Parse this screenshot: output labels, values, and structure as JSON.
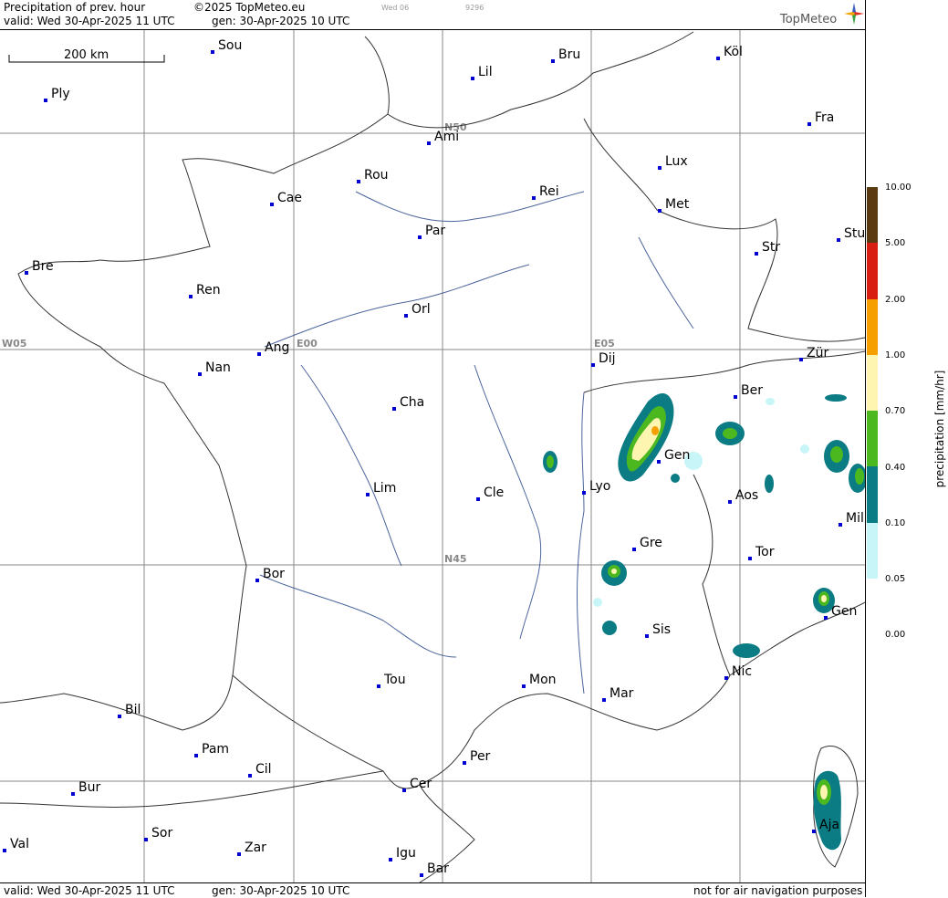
{
  "header": {
    "title": "Precipitation of prev. hour",
    "copyright": "©2025 TopMeteo.eu",
    "valid_line": "valid:  Wed  30-Apr-2025  11 UTC",
    "gen_line": "gen: 30-Apr-2025 10 UTC",
    "small_tag1": "Wed 06",
    "small_tag2": "9296"
  },
  "logo": {
    "text": "TopMeteo",
    "icon": "compass-star-icon"
  },
  "footer": {
    "valid_line": "valid:  Wed  30-Apr-2025  11 UTC",
    "gen_line": "gen: 30-Apr-2025 10 UTC",
    "disclaimer": "not for air navigation purposes"
  },
  "scale_bar": {
    "label": "200 km"
  },
  "grid_labels": {
    "n50": "N50",
    "n45": "N45",
    "w05": "W05",
    "e00": "E00",
    "e05": "E05"
  },
  "cities": [
    {
      "name": "Sou"
    },
    {
      "name": "Bru"
    },
    {
      "name": "Köl"
    },
    {
      "name": "Ply"
    },
    {
      "name": "Lil"
    },
    {
      "name": "Ami"
    },
    {
      "name": "Fra"
    },
    {
      "name": "Rou"
    },
    {
      "name": "Lux"
    },
    {
      "name": "Cae"
    },
    {
      "name": "Rei"
    },
    {
      "name": "Met"
    },
    {
      "name": "Par"
    },
    {
      "name": "Stu"
    },
    {
      "name": "Str"
    },
    {
      "name": "Bre"
    },
    {
      "name": "Ren"
    },
    {
      "name": "Orl"
    },
    {
      "name": "Ang"
    },
    {
      "name": "Dij"
    },
    {
      "name": "Zür"
    },
    {
      "name": "Nan"
    },
    {
      "name": "Cha"
    },
    {
      "name": "Ber"
    },
    {
      "name": "Gen"
    },
    {
      "name": "Lim"
    },
    {
      "name": "Cle"
    },
    {
      "name": "Lyo"
    },
    {
      "name": "Aos"
    },
    {
      "name": "Mil"
    },
    {
      "name": "Gre"
    },
    {
      "name": "Tor"
    },
    {
      "name": "Bor"
    },
    {
      "name": "Gen"
    },
    {
      "name": "Sis"
    },
    {
      "name": "Tou"
    },
    {
      "name": "Mon"
    },
    {
      "name": "Mar"
    },
    {
      "name": "Nic"
    },
    {
      "name": "Bil"
    },
    {
      "name": "Pam"
    },
    {
      "name": "Cil"
    },
    {
      "name": "Per"
    },
    {
      "name": "Bur"
    },
    {
      "name": "Cer"
    },
    {
      "name": "Sor"
    },
    {
      "name": "Val"
    },
    {
      "name": "Zar"
    },
    {
      "name": "Igu"
    },
    {
      "name": "Aja"
    },
    {
      "name": "Bar"
    }
  ],
  "legend": {
    "title": "precipitation [mm/hr]",
    "levels": [
      "10.00",
      "5.00",
      "2.00",
      "1.00",
      "0.70",
      "0.40",
      "0.10",
      "0.05",
      "0.00"
    ],
    "colors": [
      "#5a3a10",
      "#d81e10",
      "#f5a000",
      "#fdf5b0",
      "#4cb820",
      "#0b7b84",
      "#c8f6f8",
      "#ffffff"
    ]
  }
}
